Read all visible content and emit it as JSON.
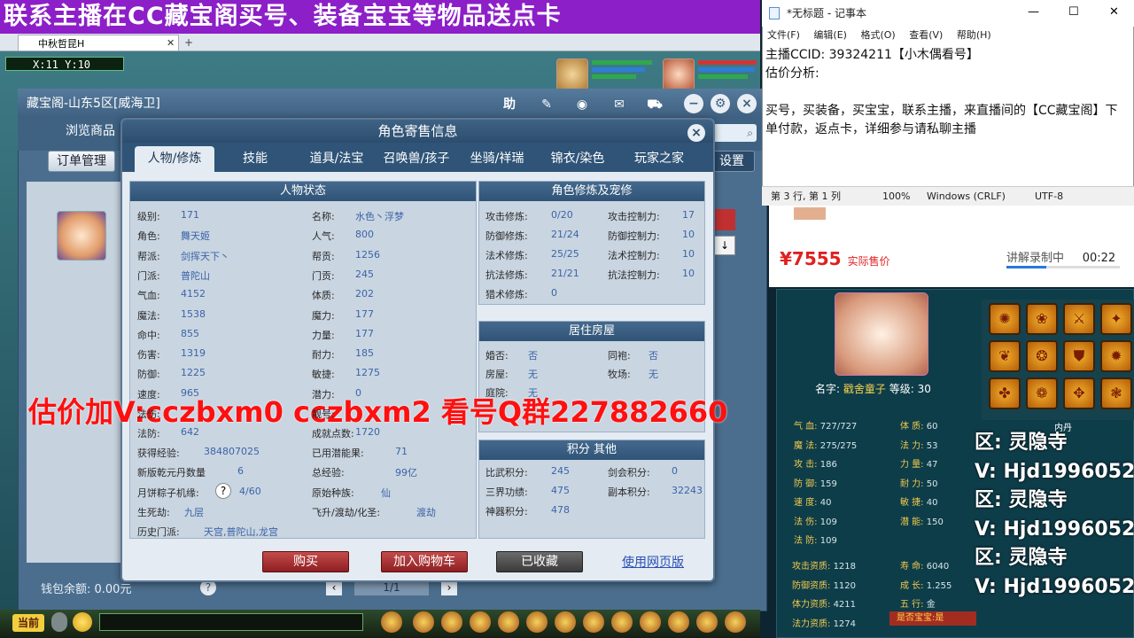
{
  "banner": {
    "text": "联系主播在CC藏宝阁买号、装备宝宝等物品送点卡"
  },
  "browser": {
    "tab_title": "中秋哲昆H",
    "tab_close": "✕",
    "tab_new": "+"
  },
  "game": {
    "coords": "X:11 Y:10"
  },
  "cbg": {
    "title": "藏宝阁-山东5区[威海卫]",
    "nav_browse": "浏览商品",
    "order_btn": "订单管理",
    "settings_btn": "设置",
    "help_label": "助",
    "wallet": "钱包余额: 0.00元",
    "help_q": "?",
    "pager": "1/1",
    "prev": "‹",
    "next": "›"
  },
  "dialog": {
    "title": "角色寄售信息",
    "close": "×",
    "tabs": [
      "人物/修炼",
      "技能",
      "道具/法宝",
      "召唤兽/孩子",
      "坐骑/祥瑞",
      "锦衣/染色",
      "玩家之家"
    ],
    "status_title": "人物状态",
    "status_left": [
      {
        "k": "级别:",
        "v": "171"
      },
      {
        "k": "角色:",
        "v": "舞天姬"
      },
      {
        "k": "帮派:",
        "v": "剑挥天下丶"
      },
      {
        "k": "门派:",
        "v": "普陀山"
      },
      {
        "k": "气血:",
        "v": "4152"
      },
      {
        "k": "魔法:",
        "v": "1538"
      },
      {
        "k": "命中:",
        "v": "855"
      },
      {
        "k": "伤害:",
        "v": "1319"
      },
      {
        "k": "防御:",
        "v": "1225"
      },
      {
        "k": "速度:",
        "v": "965"
      },
      {
        "k": "法伤:",
        "v": ""
      },
      {
        "k": "法防:",
        "v": "642"
      }
    ],
    "status_right": [
      {
        "k": "名称:",
        "v": "水色丶浮梦"
      },
      {
        "k": "人气:",
        "v": "800"
      },
      {
        "k": "帮贡:",
        "v": "1256"
      },
      {
        "k": "门贡:",
        "v": "245"
      },
      {
        "k": "体质:",
        "v": "202"
      },
      {
        "k": "魔力:",
        "v": "177"
      },
      {
        "k": "力量:",
        "v": "177"
      },
      {
        "k": "耐力:",
        "v": "185"
      },
      {
        "k": "敏捷:",
        "v": "1275"
      },
      {
        "k": "潜力:",
        "v": "0"
      },
      {
        "k": "靓号:",
        "v": ""
      },
      {
        "k": "成就点数:",
        "v": "1720"
      }
    ],
    "status_extra": [
      {
        "k": "获得经验:",
        "v": "384807025"
      },
      {
        "k": "已用潜能果:",
        "v": "71"
      },
      {
        "k": "新版乾元丹数量",
        "v": "6"
      },
      {
        "k": "总经验:",
        "v": "99亿"
      },
      {
        "k": "月饼粽子机缘:",
        "v": "4/60"
      },
      {
        "k": "原始种族:",
        "v": "仙"
      },
      {
        "k": "生死劫:",
        "v": "九层"
      },
      {
        "k": "飞升/渡劫/化圣:",
        "v": "渡劫"
      },
      {
        "k": "历史门派:",
        "v": "天宫,普陀山,龙宫"
      }
    ],
    "cultivation_title": "角色修炼及宠修",
    "cultivation": [
      {
        "k": "攻击修炼:",
        "v": "0/20",
        "k2": "攻击控制力:",
        "v2": "17"
      },
      {
        "k": "防御修炼:",
        "v": "21/24",
        "k2": "防御控制力:",
        "v2": "10"
      },
      {
        "k": "法术修炼:",
        "v": "25/25",
        "k2": "法术控制力:",
        "v2": "10"
      },
      {
        "k": "抗法修炼:",
        "v": "21/21",
        "k2": "抗法控制力:",
        "v2": "10"
      },
      {
        "k": "猎术修炼:",
        "v": "0",
        "k2": "",
        "v2": ""
      }
    ],
    "house_title": "居住房屋",
    "house": [
      {
        "k": "婚否:",
        "v": "否",
        "k2": "同袍:",
        "v2": "否"
      },
      {
        "k": "房屋:",
        "v": "无",
        "k2": "牧场:",
        "v2": "无"
      },
      {
        "k": "庭院:",
        "v": "无",
        "k2": "",
        "v2": ""
      }
    ],
    "points_title": "积分 其他",
    "points": [
      {
        "k": "比武积分:",
        "v": "245",
        "k2": "剑会积分:",
        "v2": "0"
      },
      {
        "k": "三界功绩:",
        "v": "475",
        "k2": "副本积分:",
        "v2": "32243"
      },
      {
        "k": "神器积分:",
        "v": "478",
        "k2": "",
        "v2": ""
      }
    ],
    "buy": "购买",
    "add_cart": "加入购物车",
    "favorited": "已收藏",
    "web": "使用网页版"
  },
  "overlay": {
    "promo": "估价加V:cczbxm0   cczbxm2   看号Q群227882660"
  },
  "notepad": {
    "title": "*无标题 - 记事本",
    "menu": [
      "文件(F)",
      "编辑(E)",
      "格式(O)",
      "查看(V)",
      "帮助(H)"
    ],
    "lines": [
      "主播CCID: 39324211【小木偶看号】",
      "估价分析:",
      "",
      "买号，买装备，买宝宝，联系主播，来直播间的【CC藏宝阁】下单付款，返点卡，详细参与请私聊主播"
    ],
    "status": [
      "第 3 行, 第 1 列",
      "100%",
      "Windows (CRLF)",
      "UTF-8"
    ],
    "win_min": "—",
    "win_max": "☐",
    "win_close": "✕"
  },
  "sale": {
    "price": "¥7555",
    "price_label": "实际售价",
    "recording": "讲解录制中",
    "time": "00:22"
  },
  "character": {
    "name_label": "名字:",
    "name": "戳舍童子",
    "level_label": "等级:",
    "level": "30",
    "stats_left": [
      {
        "k": "气   血:",
        "v": "727/727"
      },
      {
        "k": "魔   法:",
        "v": "275/275"
      },
      {
        "k": "攻   击:",
        "v": "186"
      },
      {
        "k": "防   御:",
        "v": "159"
      },
      {
        "k": "速   度:",
        "v": "40"
      },
      {
        "k": "法   伤:",
        "v": "109"
      },
      {
        "k": "法   防:",
        "v": "109"
      }
    ],
    "stats_right": [
      {
        "k": "体   质:",
        "v": "60"
      },
      {
        "k": "法   力:",
        "v": "53"
      },
      {
        "k": "力   量:",
        "v": "47"
      },
      {
        "k": "耐   力:",
        "v": "50"
      },
      {
        "k": "敏   捷:",
        "v": "40"
      },
      {
        "k": "潜   能:",
        "v": "150"
      }
    ],
    "apt_left": [
      {
        "k": "攻击资质:",
        "v": "1218"
      },
      {
        "k": "防御资质:",
        "v": "1120"
      },
      {
        "k": "体力资质:",
        "v": "4211"
      },
      {
        "k": "法力资质:",
        "v": "1274"
      }
    ],
    "apt_right": [
      {
        "k": "寿   命:",
        "v": "6040"
      },
      {
        "k": "成   长:",
        "v": "1.255"
      },
      {
        "k": "五   行:",
        "v": "金"
      }
    ],
    "is_baby": "是否宝宝:是",
    "inner": "内丹",
    "skills": [
      "✺",
      "❀",
      "⚔",
      "✦",
      "❦",
      "❂",
      "⛊",
      "✹",
      "✤",
      "❁",
      "✥",
      "❃"
    ]
  },
  "side_ads": [
    "区: 灵隐寺",
    "V: Hjd1996052",
    "区: 灵隐寺",
    "V: Hjd1996052",
    "区: 灵隐寺",
    "V: Hjd1996052"
  ],
  "bottom": {
    "current": "当前"
  }
}
